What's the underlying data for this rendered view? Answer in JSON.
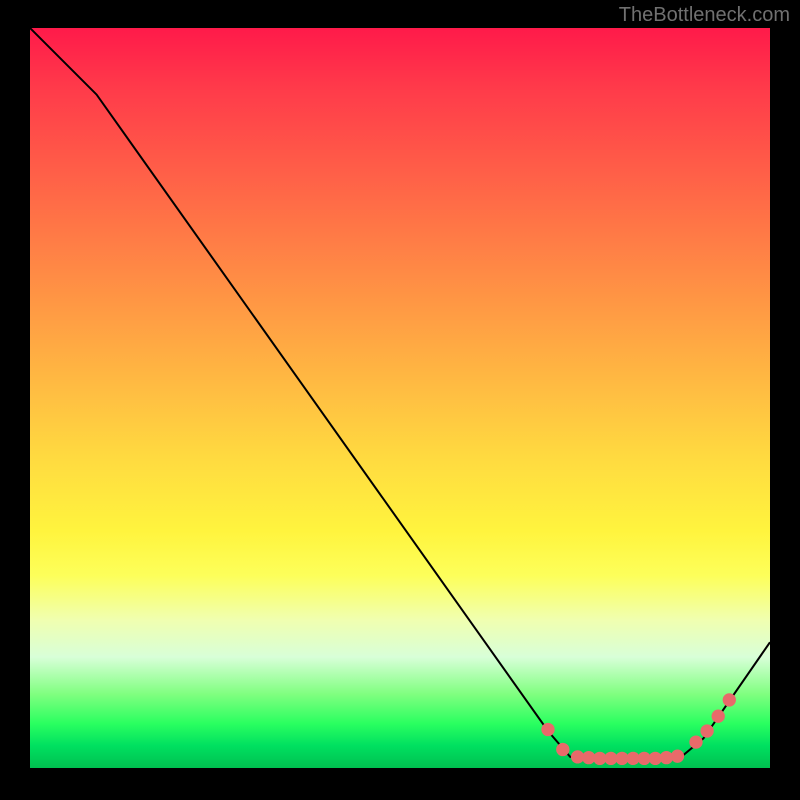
{
  "attribution": "TheBottleneck.com",
  "chart_data": {
    "type": "line",
    "title": "",
    "xlabel": "",
    "ylabel": "",
    "xlim": [
      0,
      100
    ],
    "ylim": [
      0,
      100
    ],
    "series": [
      {
        "name": "bottleneck-curve",
        "points": [
          {
            "x": 0,
            "y": 100
          },
          {
            "x": 9,
            "y": 91
          },
          {
            "x": 70,
            "y": 5
          },
          {
            "x": 73,
            "y": 1.5
          },
          {
            "x": 88,
            "y": 1.5
          },
          {
            "x": 91,
            "y": 4
          },
          {
            "x": 100,
            "y": 17
          }
        ]
      }
    ],
    "markers": [
      {
        "x": 70,
        "y": 5.2
      },
      {
        "x": 72,
        "y": 2.5
      },
      {
        "x": 74,
        "y": 1.5
      },
      {
        "x": 75.5,
        "y": 1.4
      },
      {
        "x": 77,
        "y": 1.3
      },
      {
        "x": 78.5,
        "y": 1.3
      },
      {
        "x": 80,
        "y": 1.3
      },
      {
        "x": 81.5,
        "y": 1.3
      },
      {
        "x": 83,
        "y": 1.3
      },
      {
        "x": 84.5,
        "y": 1.3
      },
      {
        "x": 86,
        "y": 1.4
      },
      {
        "x": 87.5,
        "y": 1.6
      },
      {
        "x": 90,
        "y": 3.5
      },
      {
        "x": 91.5,
        "y": 5.0
      },
      {
        "x": 93,
        "y": 7.0
      },
      {
        "x": 94.5,
        "y": 9.2
      }
    ],
    "marker_color": "#e86a6a",
    "line_color": "#000000"
  }
}
